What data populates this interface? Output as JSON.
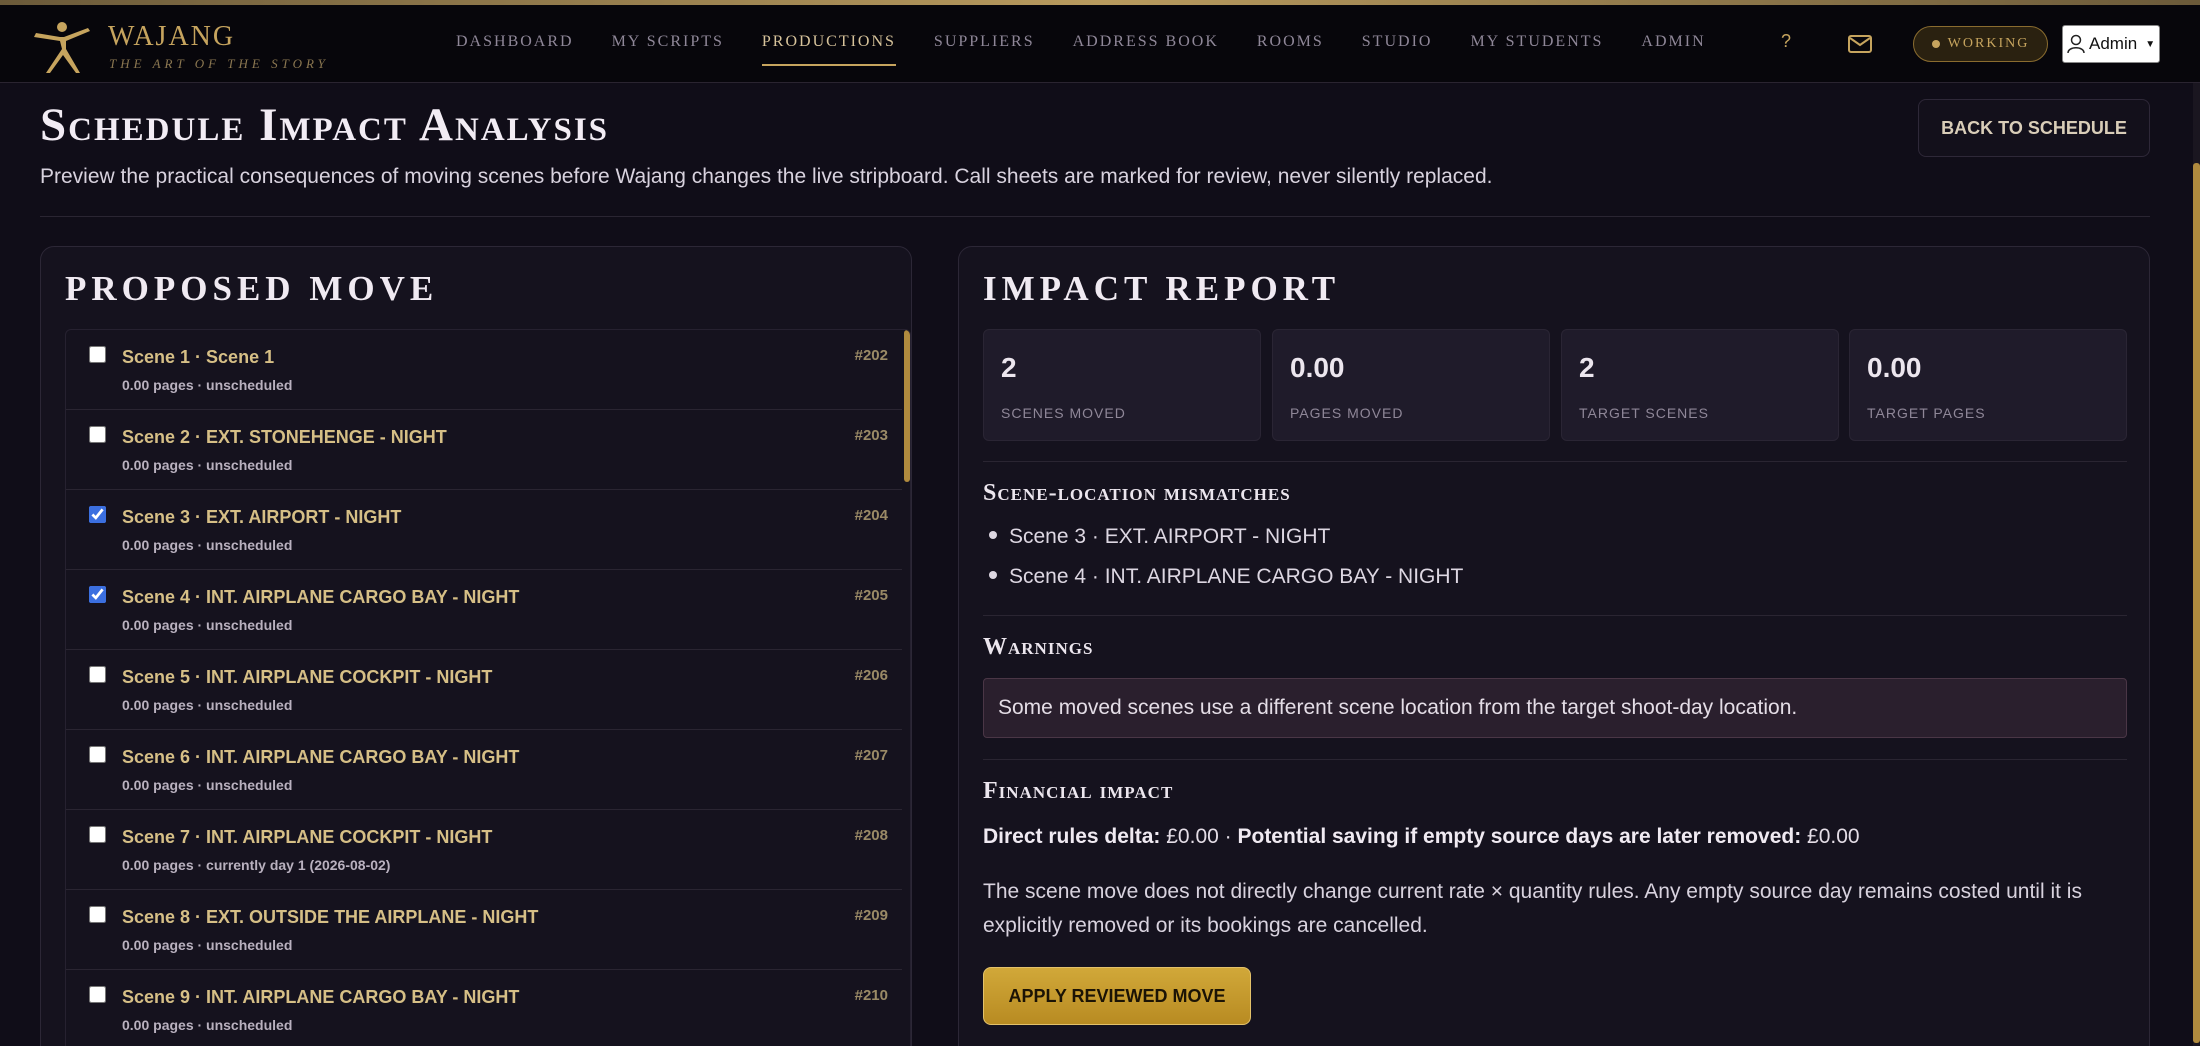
{
  "brand": {
    "name": "WAJANG",
    "tagline": "THE ART OF THE STORY"
  },
  "nav": {
    "items": [
      {
        "label": "DASHBOARD"
      },
      {
        "label": "MY SCRIPTS"
      },
      {
        "label": "PRODUCTIONS"
      },
      {
        "label": "SUPPLIERS"
      },
      {
        "label": "ADDRESS BOOK"
      },
      {
        "label": "ROOMS"
      },
      {
        "label": "STUDIO"
      },
      {
        "label": "MY STUDENTS"
      },
      {
        "label": "ADMIN"
      }
    ],
    "active": "PRODUCTIONS",
    "help_label": "?",
    "status_label": "WORKING",
    "user_label": "Admin"
  },
  "page": {
    "title": "Schedule Impact Analysis",
    "subtitle": "Preview the practical consequences of moving scenes before Wajang changes the live stripboard. Call sheets are marked for review, never silently replaced.",
    "back_button": "BACK TO SCHEDULE"
  },
  "proposed_move": {
    "title": "PROPOSED MOVE",
    "scenes": [
      {
        "title": "Scene 1 · Scene 1",
        "meta": "0.00 pages · unscheduled",
        "number": "#202",
        "checked": false
      },
      {
        "title": "Scene 2 · EXT. STONEHENGE - NIGHT",
        "meta": "0.00 pages · unscheduled",
        "number": "#203",
        "checked": false
      },
      {
        "title": "Scene 3 · EXT. AIRPORT - NIGHT",
        "meta": "0.00 pages · unscheduled",
        "number": "#204",
        "checked": true
      },
      {
        "title": "Scene 4 · INT. AIRPLANE CARGO BAY - NIGHT",
        "meta": "0.00 pages · unscheduled",
        "number": "#205",
        "checked": true
      },
      {
        "title": "Scene 5 · INT. AIRPLANE COCKPIT - NIGHT",
        "meta": "0.00 pages · unscheduled",
        "number": "#206",
        "checked": false
      },
      {
        "title": "Scene 6 · INT. AIRPLANE CARGO BAY - NIGHT",
        "meta": "0.00 pages · unscheduled",
        "number": "#207",
        "checked": false
      },
      {
        "title": "Scene 7 · INT. AIRPLANE COCKPIT - NIGHT",
        "meta": "0.00 pages · currently day 1 (2026-08-02)",
        "number": "#208",
        "checked": false
      },
      {
        "title": "Scene 8 · EXT. OUTSIDE THE AIRPLANE - NIGHT",
        "meta": "0.00 pages · unscheduled",
        "number": "#209",
        "checked": false
      },
      {
        "title": "Scene 9 · INT. AIRPLANE CARGO BAY - NIGHT",
        "meta": "0.00 pages · unscheduled",
        "number": "#210",
        "checked": false
      }
    ]
  },
  "impact": {
    "title": "IMPACT REPORT",
    "stats": [
      {
        "value": "2",
        "label": "SCENES MOVED"
      },
      {
        "value": "0.00",
        "label": "PAGES MOVED"
      },
      {
        "value": "2",
        "label": "TARGET SCENES"
      },
      {
        "value": "0.00",
        "label": "TARGET PAGES"
      }
    ],
    "mismatch_heading": "Scene-location mismatches",
    "mismatches": [
      "Scene 3 · EXT. AIRPORT - NIGHT",
      "Scene 4 · INT. AIRPLANE CARGO BAY - NIGHT"
    ],
    "warnings_heading": "Warnings",
    "warning_text": "Some moved scenes use a different scene location from the target shoot-day location.",
    "financial_heading": "Financial impact",
    "direct_delta_label": "Direct rules delta:",
    "direct_delta_value": "£0.00 ·",
    "saving_label": "Potential saving if empty source days are later removed:",
    "saving_value": "£0.00",
    "financial_note": "The scene move does not directly change current rate × quantity rules. Any empty source day remains costed until it is explicitly removed or its bookings are cancelled.",
    "apply_button": "APPLY REVIEWED MOVE"
  },
  "colors": {
    "accent": "#c6a45e",
    "background": "#100d18",
    "panel": "#15121e",
    "checkbox": "#3b6fe0"
  },
  "icons": {
    "brand": "star-figure-icon",
    "help": "question-icon",
    "mail": "mail-icon",
    "user": "user-icon"
  }
}
